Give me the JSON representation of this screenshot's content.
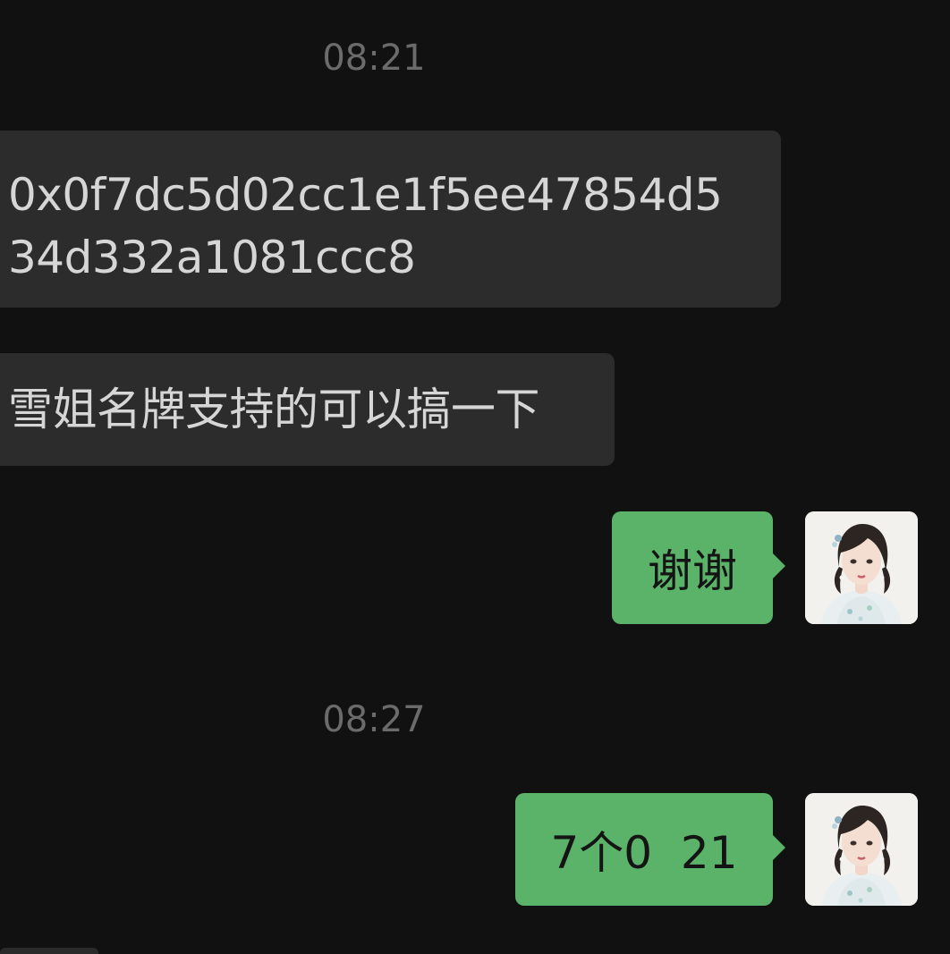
{
  "chat": {
    "timestamps": [
      "08:21",
      "08:27"
    ],
    "messages": [
      {
        "direction": "incoming",
        "text_lines": [
          "0x0f7dc5d02cc1e1f5ee47854d5",
          "34d332a1081ccc8"
        ]
      },
      {
        "direction": "incoming",
        "text": "雪姐名牌支持的可以搞一下"
      },
      {
        "direction": "outgoing",
        "text": "谢谢"
      },
      {
        "direction": "outgoing",
        "text": "7个0  21"
      }
    ]
  },
  "user": {
    "avatar": "user-avatar-portrait"
  },
  "colors": {
    "background": "#111111",
    "incoming_bubble": "#2c2c2c",
    "outgoing_bubble": "#5bb36a",
    "timestamp_text": "#6b6b6b"
  }
}
